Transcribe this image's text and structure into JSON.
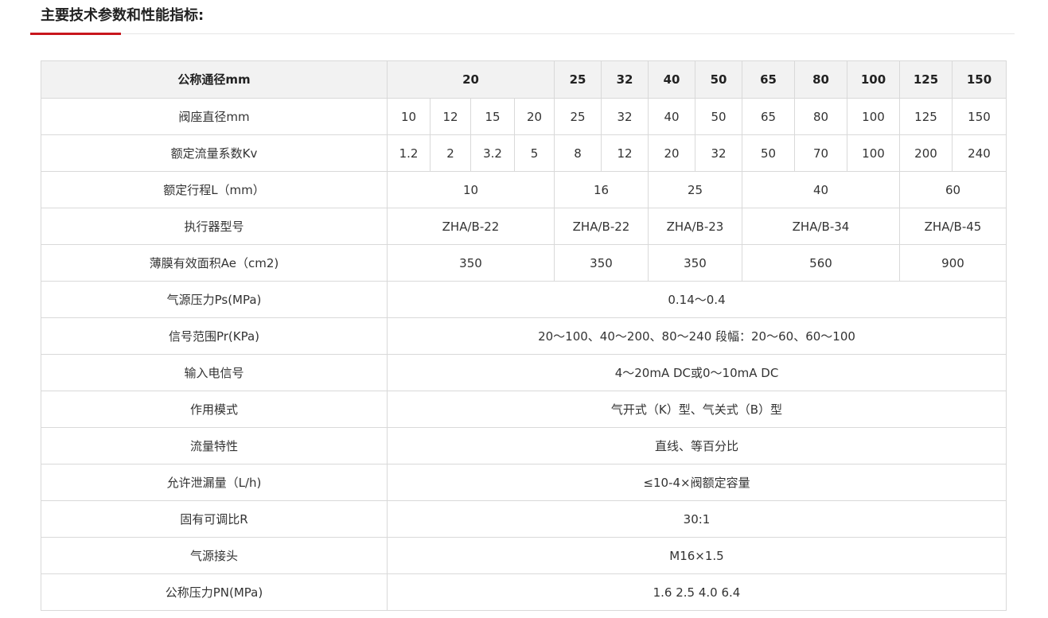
{
  "title": "主要技术参数和性能指标:",
  "colors": {
    "accent": "#c8161d",
    "header_bg": "#f2f2f2",
    "border": "#d9d9d9"
  },
  "table": {
    "header": {
      "label": "公称通径mm",
      "values": [
        "20",
        "25",
        "32",
        "40",
        "50",
        "65",
        "80",
        "100",
        "125",
        "150"
      ]
    },
    "seat_diameter": {
      "label": "阀座直径mm",
      "values": [
        "10",
        "12",
        "15",
        "20",
        "25",
        "32",
        "40",
        "50",
        "65",
        "80",
        "100",
        "125",
        "150"
      ]
    },
    "kv": {
      "label": "额定流量系数Kv",
      "values": [
        "1.2",
        "2",
        "3.2",
        "5",
        "8",
        "12",
        "20",
        "32",
        "50",
        "70",
        "100",
        "200",
        "240"
      ]
    },
    "stroke": {
      "label": "额定行程L（mm）",
      "values": [
        "10",
        "16",
        "25",
        "40",
        "60"
      ]
    },
    "actuator": {
      "label": "执行器型号",
      "values": [
        "ZHA/B-22",
        "ZHA/B-22",
        "ZHA/B-23",
        "ZHA/B-34",
        "ZHA/B-45"
      ]
    },
    "area": {
      "label": "薄膜有效面积Ae（cm2)",
      "values": [
        "350",
        "350",
        "350",
        "560",
        "900"
      ]
    },
    "supply_pressure": {
      "label": "气源压力Ps(MPa)",
      "value": "0.14～0.4"
    },
    "signal_range": {
      "label": "信号范围Pr(KPa)",
      "value": "20～100、40～200、80～240 段幅：20～60、60～100"
    },
    "input_signal": {
      "label": "输入电信号",
      "value": "4～20mA DC或0～10mA DC"
    },
    "action_mode": {
      "label": "作用模式",
      "value": "气开式（K）型、气关式（B）型"
    },
    "flow_characteristic": {
      "label": "流量特性",
      "value": "直线、等百分比"
    },
    "leakage": {
      "label": "允许泄漏量（L/h)",
      "value": "≤10-4×阀额定容量"
    },
    "rangeability": {
      "label": "固有可调比R",
      "value": "30:1"
    },
    "air_connection": {
      "label": "气源接头",
      "value": "M16×1.5"
    },
    "nominal_pressure": {
      "label": "公称压力PN(MPa)",
      "value": "1.6 2.5 4.0 6.4"
    }
  }
}
